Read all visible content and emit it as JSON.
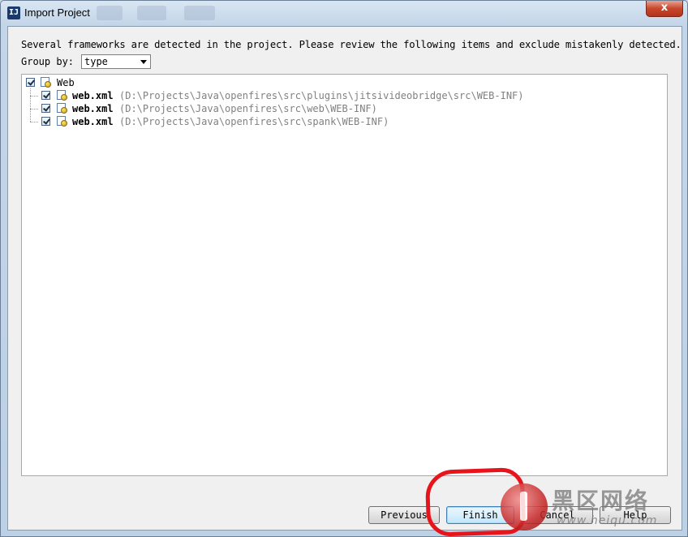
{
  "window": {
    "title": "Import Project",
    "icon": "intellij-idea-icon",
    "close_label": "x"
  },
  "description": "Several frameworks are detected in the project. Please review the following items and exclude mistakenly detected.",
  "group_by": {
    "label": "Group by:",
    "value": "type"
  },
  "tree": {
    "root": {
      "label": "Web",
      "checked": true,
      "icon": "web-framework-icon"
    },
    "items": [
      {
        "name": "web.xml",
        "path": "(D:\\Projects\\Java\\openfires\\src\\plugins\\jitsivideobridge\\src\\WEB-INF)",
        "checked": true
      },
      {
        "name": "web.xml",
        "path": "(D:\\Projects\\Java\\openfires\\src\\web\\WEB-INF)",
        "checked": true
      },
      {
        "name": "web.xml",
        "path": "(D:\\Projects\\Java\\openfires\\src\\spank\\WEB-INF)",
        "checked": true
      }
    ]
  },
  "buttons": {
    "previous": "Previous",
    "finish": "Finish",
    "cancel": "Cancel",
    "help": "Help"
  },
  "watermark": {
    "text": "黑区网络",
    "url": "www.heiqu.com"
  },
  "colors": {
    "annotation": "#e8141c",
    "path_text": "#808080"
  }
}
